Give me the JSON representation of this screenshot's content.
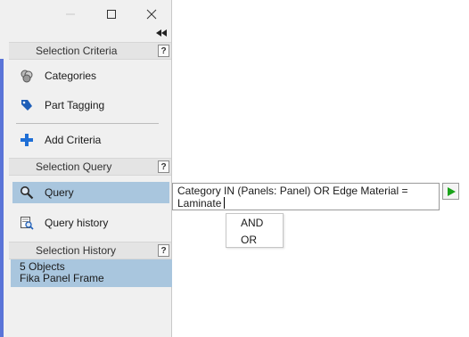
{
  "colors": {
    "selection": "#a9c6de",
    "accent_bar": "#5a74d8",
    "run_arrow": "#1aa31a",
    "add_icon": "#1f6fd6"
  },
  "window_controls": {
    "minimize": "—",
    "maximize": "☐",
    "close": "✕"
  },
  "collapse_glyph": "◂◂",
  "sections": {
    "criteria": {
      "title": "Selection Criteria",
      "help": "?"
    },
    "query": {
      "title": "Selection Query",
      "help": "?"
    },
    "history": {
      "title": "Selection History",
      "help": "?"
    }
  },
  "criteria_items": [
    {
      "label": "Categories",
      "icon": "categories-icon"
    },
    {
      "label": "Part Tagging",
      "icon": "tag-icon"
    },
    {
      "label": "Add Criteria",
      "icon": "plus-icon"
    }
  ],
  "query_items": [
    {
      "label": "Query",
      "icon": "magnifier-icon",
      "selected": true
    },
    {
      "label": "Query history",
      "icon": "query-history-icon",
      "selected": false
    }
  ],
  "history_entry": {
    "line1": "5 Objects",
    "line2": "Fika Panel Frame"
  },
  "query_editor": {
    "line1": "Category IN (Panels: Panel) OR Edge Material =",
    "line2": "Laminate"
  },
  "autocomplete": [
    "AND",
    "OR"
  ]
}
